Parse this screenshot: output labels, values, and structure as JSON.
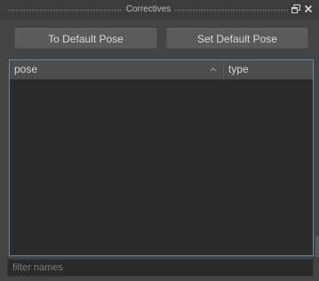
{
  "window": {
    "title": "Correctives",
    "float_icon": "float-window-icon",
    "close_icon": "close-icon"
  },
  "toolbar": {
    "to_default_label": "To Default Pose",
    "set_default_label": "Set Default Pose"
  },
  "table": {
    "columns": [
      "pose",
      "type"
    ],
    "sorted_column": "pose",
    "sort_icon": "sort-indicator-icon",
    "rows": []
  },
  "filter": {
    "placeholder": "filter names",
    "value": ""
  },
  "colors": {
    "panel_bg": "#444444",
    "table_bg": "#2b2b2b",
    "table_border_accent": "#5f8bab",
    "button_bg": "#5b5b5b"
  }
}
